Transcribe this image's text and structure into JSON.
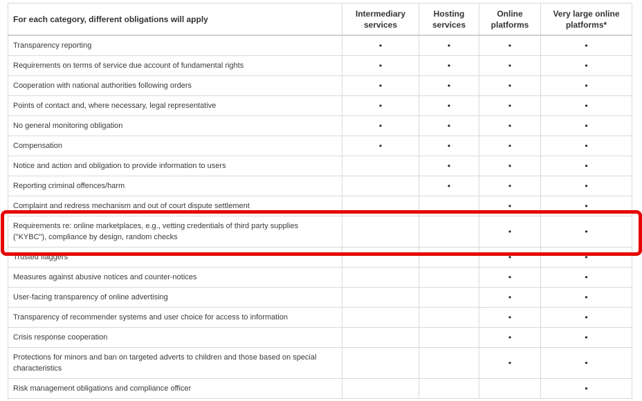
{
  "header": {
    "category": "For each category, different obligations will apply",
    "columns": [
      "Intermediary services",
      "Hosting services",
      "Online platforms",
      "Very large online platforms*"
    ]
  },
  "rows": [
    {
      "label": "Transparency reporting",
      "marks": [
        "•",
        "•",
        "•",
        "•"
      ]
    },
    {
      "label": "Requirements on terms of service due account of fundamental rights",
      "marks": [
        "•",
        "•",
        "•",
        "•"
      ]
    },
    {
      "label": "Cooperation with national authorities following orders",
      "marks": [
        "•",
        "•",
        "•",
        "•"
      ]
    },
    {
      "label": "Points of contact and, where necessary, legal representative",
      "marks": [
        "•",
        "•",
        "•",
        "•"
      ]
    },
    {
      "label": "No general monitoring obligation",
      "marks": [
        "•",
        "•",
        "•",
        "•"
      ]
    },
    {
      "label": "Compensation",
      "marks": [
        "•",
        "•",
        "•",
        "•"
      ]
    },
    {
      "label": "Notice and action and obligation to provide information to users",
      "marks": [
        "",
        "•",
        "•",
        "•"
      ]
    },
    {
      "label": "Reporting criminal offences/harm",
      "marks": [
        "",
        "•",
        "•",
        "•"
      ]
    },
    {
      "label": "Complaint and redress mechanism and out of court dispute settlement",
      "marks": [
        "",
        "",
        "•",
        "•"
      ]
    },
    {
      "label": "Requirements re: online marketplaces, e.g., vetting credentials of third party supplies (\"KYBC\"), compliance by design, random checks",
      "marks": [
        "",
        "",
        "•",
        "•"
      ]
    },
    {
      "label": "Trusted flaggers",
      "marks": [
        "",
        "",
        "•",
        "•"
      ]
    },
    {
      "label": "Measures against abusive notices and counter-notices",
      "marks": [
        "",
        "",
        "•",
        "•"
      ]
    },
    {
      "label": "User-facing transparency of online advertising",
      "marks": [
        "",
        "",
        "•",
        "•"
      ]
    },
    {
      "label": "Transparency of recommender systems and user choice for access to information",
      "marks": [
        "",
        "",
        "•",
        "•"
      ]
    },
    {
      "label": "Crisis response cooperation",
      "marks": [
        "",
        "",
        "•",
        "•"
      ]
    },
    {
      "label": "Protections for minors and ban on targeted adverts to children and those based on special characteristics",
      "marks": [
        "",
        "",
        "•",
        "•"
      ]
    },
    {
      "label": "Risk management obligations and compliance officer",
      "marks": [
        "",
        "",
        "",
        "•"
      ]
    }
  ],
  "highlight": {
    "color": "#e60000"
  }
}
